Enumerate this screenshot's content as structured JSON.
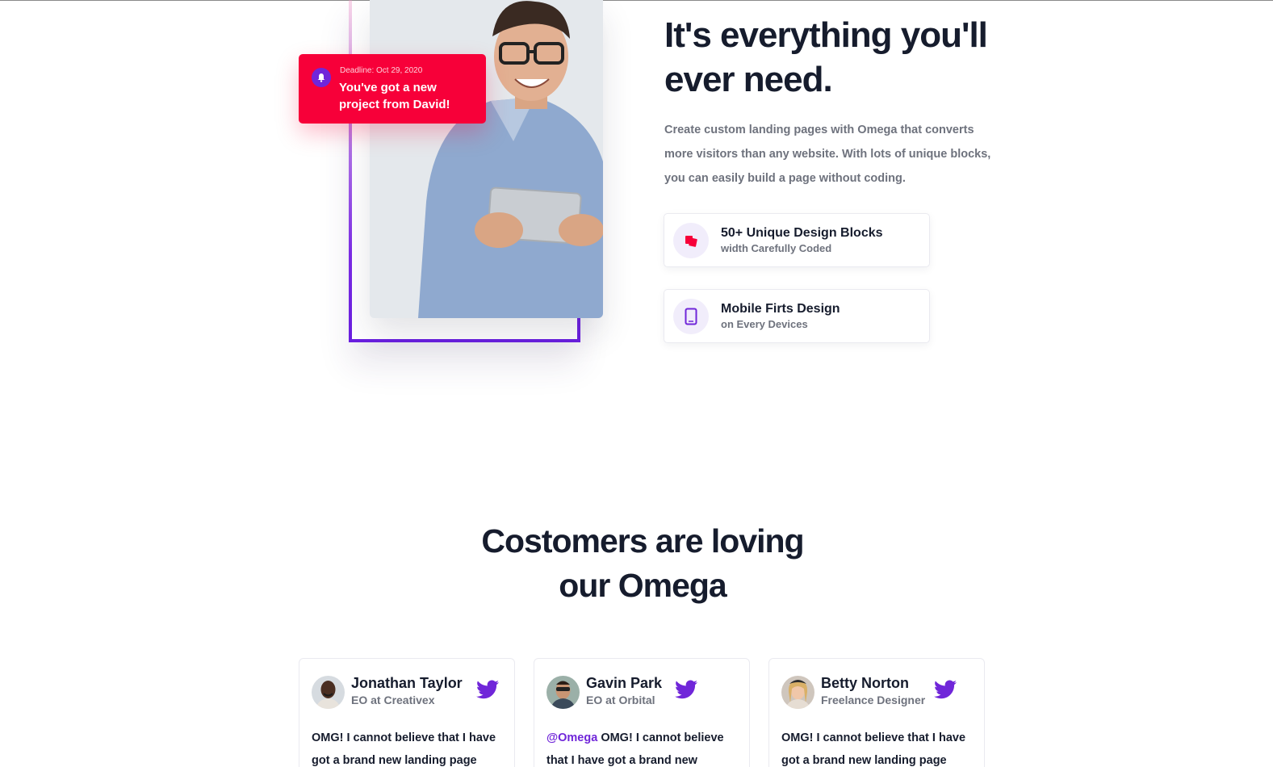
{
  "notification": {
    "date": "Deadline: Oct 29, 2020",
    "message": "You've got a new project from David!"
  },
  "hero": {
    "title": "It's everything you'll ever need.",
    "description": "Create custom landing pages with Omega that converts more visitors than any website. With lots of unique blocks, you can easily build a page without coding."
  },
  "features": [
    {
      "title": "50+ Unique Design Blocks",
      "subtitle": "width Carefully Coded",
      "icon": "layers-icon"
    },
    {
      "title": "Mobile Firts Design",
      "subtitle": "on Every Devices",
      "icon": "tablet-icon"
    }
  ],
  "testimonials_section": {
    "title": "Costomers are loving our Omega"
  },
  "testimonials": [
    {
      "name": "Jonathan Taylor",
      "role": "EO at Creativex",
      "mention": "",
      "text": "OMG! I cannot believe that I have got a brand new landing page"
    },
    {
      "name": "Gavin Park",
      "role": "EO at Orbital",
      "mention": "@Omega",
      "text": " OMG! I cannot believe that I have got a brand new"
    },
    {
      "name": "Betty Norton",
      "role": "Freelance Designer",
      "mention": "",
      "text": "OMG! I cannot believe that I have got a brand new landing page"
    }
  ],
  "colors": {
    "accent": "#7026d9",
    "notification": "#f70039",
    "heading": "#161c2d",
    "muted": "#6e727d"
  }
}
